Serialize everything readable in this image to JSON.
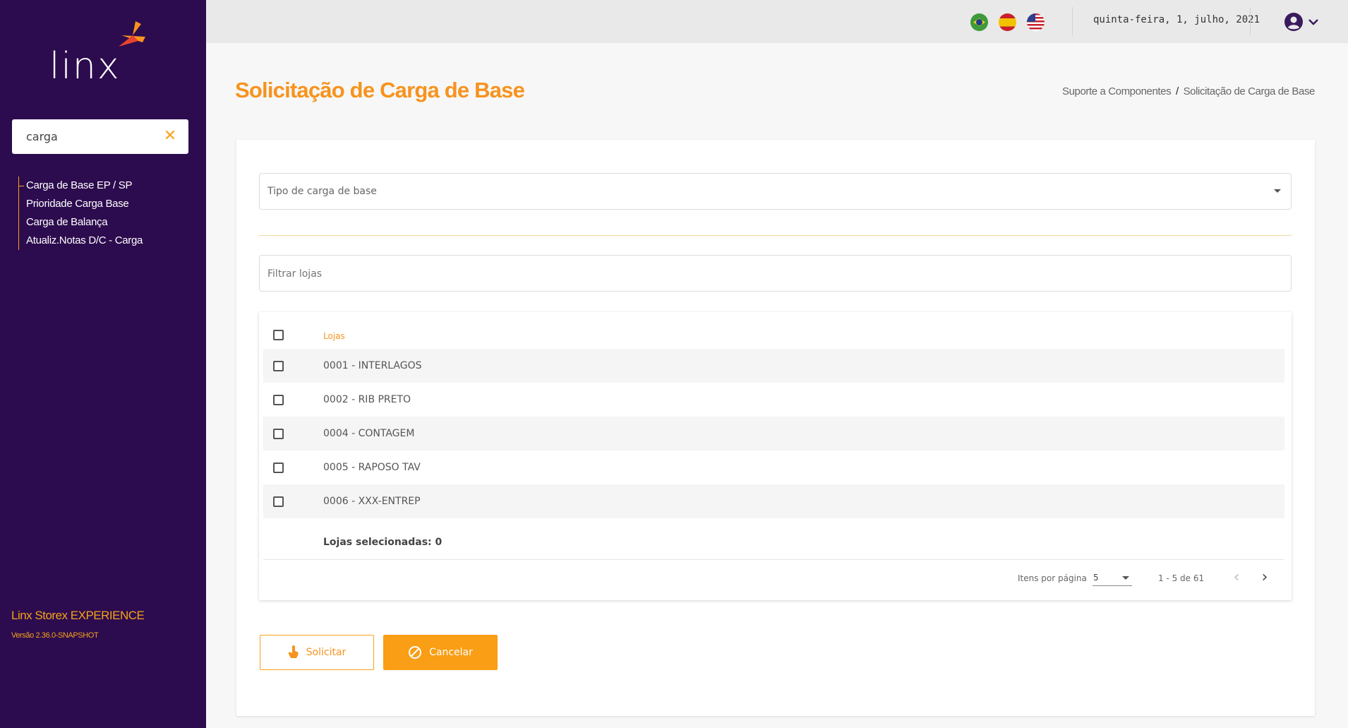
{
  "sidebar": {
    "logo_text": "linx",
    "search": {
      "value": "carga"
    },
    "menu_items": [
      {
        "label": "Carga de Base EP / SP"
      },
      {
        "label": "Prioridade Carga Base"
      },
      {
        "label": "Carga de Balança"
      },
      {
        "label": "Atualiz.Notas D/C - Carga"
      }
    ],
    "brand": "Linx Storex EXPERIENCE",
    "version": "Versão 2.36.0-SNAPSHOT"
  },
  "header": {
    "flags": [
      "flag-brazil-icon",
      "flag-spain-icon",
      "flag-usa-icon"
    ],
    "date": "quinta-feira, 1, julho, 2021"
  },
  "page": {
    "title": "Solicitação de Carga de Base",
    "breadcrumb": {
      "parent": "Suporte a Componentes",
      "separator": "/",
      "current": "Solicitação de Carga de Base"
    }
  },
  "form": {
    "type_select_placeholder": "Tipo de carga de base",
    "filter_placeholder": "Filtrar lojas"
  },
  "table": {
    "header": "Lojas",
    "rows": [
      {
        "label": "0001 - INTERLAGOS"
      },
      {
        "label": "0002 - RIB PRETO"
      },
      {
        "label": "0004 - CONTAGEM"
      },
      {
        "label": "0005 - RAPOSO TAV"
      },
      {
        "label": "0006 - XXX-ENTREP"
      }
    ],
    "selected_summary": "Lojas selecionadas: 0",
    "paginator": {
      "items_per_page_label": "Itens por página",
      "items_per_page": "5",
      "range": "1 - 5 de 61"
    }
  },
  "actions": {
    "submit_label": "Solicitar",
    "cancel_label": "Cancelar"
  },
  "colors": {
    "sidebar_bg": "#2c0b4e",
    "accent": "#f7931e",
    "cancel_bg": "#f99e15"
  }
}
